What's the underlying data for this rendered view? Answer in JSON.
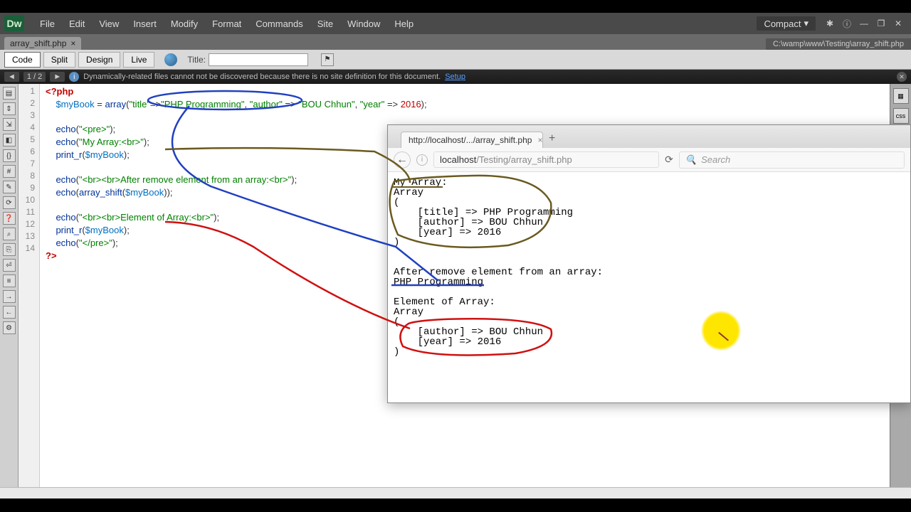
{
  "app": {
    "logo": "Dw",
    "menus": [
      "File",
      "Edit",
      "View",
      "Insert",
      "Modify",
      "Format",
      "Commands",
      "Site",
      "Window",
      "Help"
    ],
    "layout": "Compact"
  },
  "doc": {
    "tab": "array_shift.php",
    "path": "C:\\wamp\\www\\Testing\\array_shift.php"
  },
  "views": {
    "code": "Code",
    "split": "Split",
    "design": "Design",
    "live": "Live"
  },
  "titleLabel": "Title:",
  "info": {
    "nav": "1 / 2",
    "msg": "Dynamically-related files cannot not be discovered because there is no site definition for this document.",
    "link": "Setup"
  },
  "lines": [
    "1",
    "2",
    "3",
    "4",
    "5",
    "6",
    "7",
    "8",
    "9",
    "10",
    "11",
    "12",
    "13",
    "14"
  ],
  "code": {
    "l1a": "<?php",
    "l2a": "    ",
    "l2b": "$myBook",
    "l2c": " = ",
    "l2d": "array",
    "l2e": "(",
    "l2f": "\"title\"",
    "l2g": "=>",
    "l2h": "\"PHP Programming\"",
    "l2i": ", ",
    "l2j": "\"author\"",
    "l2k": " => ",
    "l2l": "\"BOU Chhun\"",
    "l2m": ", ",
    "l2n": "\"year\"",
    "l2o": " => ",
    "l2p": "2016",
    "l2q": ");",
    "l4a": "    ",
    "l4b": "echo",
    "l4c": "(",
    "l4d": "\"<pre>\"",
    "l4e": ");",
    "l5a": "    ",
    "l5b": "echo",
    "l5c": "(",
    "l5d": "\"My Array:<br>\"",
    "l5e": ");",
    "l6a": "    ",
    "l6b": "print_r",
    "l6c": "(",
    "l6d": "$myBook",
    "l6e": ");",
    "l8a": "    ",
    "l8b": "echo",
    "l8c": "(",
    "l8d": "\"<br><br>After remove element from an array:<br>\"",
    "l8e": ");",
    "l9a": "    ",
    "l9b": "echo",
    "l9c": "(",
    "l9d": "array_shift",
    "l9e": "(",
    "l9f": "$myBook",
    "l9g": "));",
    "l11a": "    ",
    "l11b": "echo",
    "l11c": "(",
    "l11d": "\"<br><br>Element of Array:<br>\"",
    "l11e": ");",
    "l12a": "    ",
    "l12b": "print_r",
    "l12c": "(",
    "l12d": "$myBook",
    "l12e": ");",
    "l13a": "    ",
    "l13b": "echo",
    "l13c": "(",
    "l13d": "\"</pre>\"",
    "l13e": ");",
    "l14a": "?>"
  },
  "browser": {
    "tab": "http://localhost/.../array_shift.php",
    "urlHost": "localhost",
    "urlPath": "/Testing/array_shift.php",
    "searchPlaceholder": "Search",
    "output": "My Array:\nArray\n(\n    [title] => PHP Programming\n    [author] => BOU Chhun\n    [year] => 2016\n)\n\n\nAfter remove element from an array:\nPHP Programming\n\nElement of Array:\nArray\n(\n    [author] => BOU Chhun\n    [year] => 2016\n)"
  }
}
